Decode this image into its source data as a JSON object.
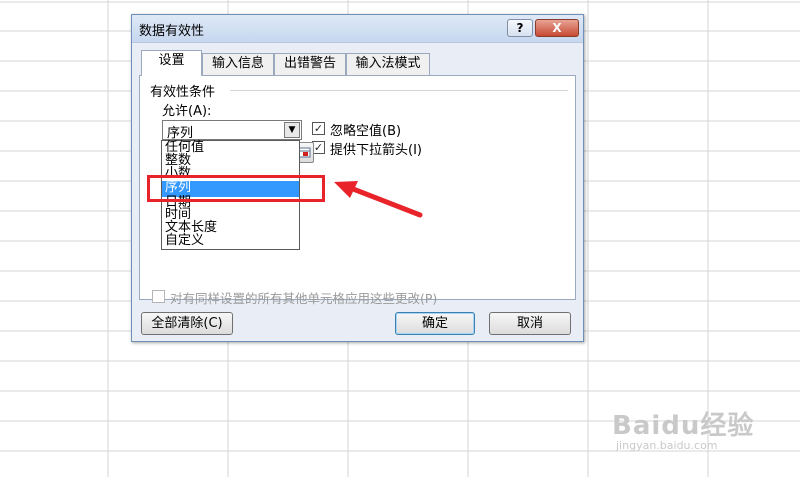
{
  "dialog": {
    "title": "数据有效性",
    "help_label": "?",
    "close_label": "X",
    "tabs": [
      {
        "label": "设置",
        "active": true
      },
      {
        "label": "输入信息",
        "active": false
      },
      {
        "label": "出错警告",
        "active": false
      },
      {
        "label": "输入法模式",
        "active": false
      }
    ],
    "group_title": "有效性条件",
    "allow_label": "允许(A):",
    "allow_value": "序列",
    "ignore_blank": {
      "label": "忽略空值(B)",
      "checked": true
    },
    "in_cell_dropdown": {
      "label": "提供下拉箭头(I)",
      "checked": true
    },
    "allow_options": [
      "任何值",
      "整数",
      "小数",
      "序列",
      "日期",
      "时间",
      "文本长度",
      "自定义"
    ],
    "selected_option": "序列",
    "apply_all": {
      "label": "对有同样设置的所有其他单元格应用这些更改(P)",
      "checked": false,
      "disabled": true
    },
    "clear_all_label": "全部清除(C)",
    "ok_label": "确定",
    "cancel_label": "取消"
  },
  "annotation": {
    "highlight_color": "#e8242a"
  },
  "watermark": {
    "brand": "Baidu经验",
    "url": "jingyan.baidu.com"
  },
  "colors": {
    "selection": "#3399ff",
    "grid_line": "#d4d4d4"
  }
}
